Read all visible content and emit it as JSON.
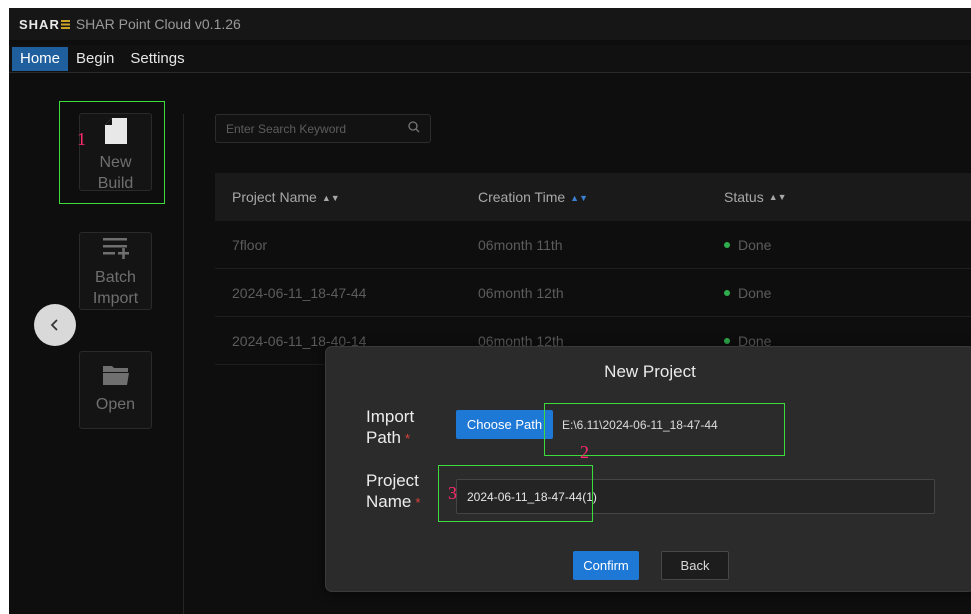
{
  "app": {
    "logo_text": "SHAR",
    "title": "SHAR Point Cloud v0.1.26"
  },
  "menu": {
    "items": [
      {
        "label": "Home",
        "active": true
      },
      {
        "label": "Begin",
        "active": false
      },
      {
        "label": "Settings",
        "active": false
      }
    ]
  },
  "toolbar": {
    "new_build": {
      "line1": "New",
      "line2": "Build",
      "icon": "new-file-icon"
    },
    "batch_import": {
      "line1": "Batch",
      "line2": "Import",
      "icon": "batch-import-icon"
    },
    "open": {
      "label": "Open",
      "icon": "folder-icon"
    }
  },
  "search": {
    "placeholder": "Enter Search Keyword",
    "icon": "search-icon"
  },
  "table": {
    "headers": {
      "name": "Project Name",
      "time": "Creation Time",
      "status": "Status"
    },
    "rows": [
      {
        "name": "7floor",
        "time": "06month 11th",
        "status": "Done"
      },
      {
        "name": "2024-06-11_18-47-44",
        "time": "06month 12th",
        "status": "Done"
      },
      {
        "name": "2024-06-11_18-40-14",
        "time": "06month 12th",
        "status": "Done"
      }
    ]
  },
  "dialog": {
    "title": "New Project",
    "import_label_line1": "Import",
    "import_label_line2": "Path",
    "choose_path_label": "Choose Path",
    "path_value": "E:\\6.11\\2024-06-11_18-47-44",
    "name_label_line1": "Project",
    "name_label_line2": "Name",
    "name_value": "2024-06-11_18-47-44(1)",
    "required_mark": "*",
    "confirm_label": "Confirm",
    "back_label": "Back"
  },
  "annotations": [
    "1",
    "2",
    "3"
  ],
  "colors": {
    "accent_blue": "#1e78d6",
    "active_menu": "#1f5f9e",
    "status_done": "#2eae4d",
    "annotation_box": "#3ddc3d",
    "annotation_number": "#ff2a6d",
    "logo_accent": "#c9a227"
  }
}
